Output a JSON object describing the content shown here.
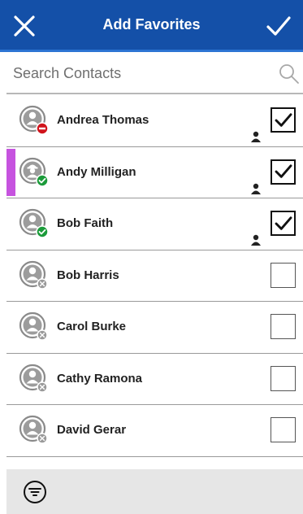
{
  "header": {
    "title": "Add Favorites",
    "close_icon": "close-icon",
    "confirm_icon": "check-icon",
    "bg_color": "#1450a8"
  },
  "search": {
    "placeholder": "Search Contacts",
    "value": "",
    "icon": "search-icon"
  },
  "contacts": [
    {
      "name": "Andrea Thomas",
      "status": "busy",
      "checked": true,
      "highlight": false,
      "avatar_icon": "person-icon"
    },
    {
      "name": "Andy Milligan",
      "status": "available",
      "checked": true,
      "highlight": true,
      "avatar_icon": "hard-hat-person-icon"
    },
    {
      "name": "Bob Faith",
      "status": "available",
      "checked": true,
      "highlight": false,
      "avatar_icon": "person-icon"
    },
    {
      "name": "Bob Harris",
      "status": "offline",
      "checked": false,
      "highlight": false,
      "avatar_icon": "person-icon"
    },
    {
      "name": "Carol Burke",
      "status": "offline",
      "checked": false,
      "highlight": false,
      "avatar_icon": "person-icon"
    },
    {
      "name": "Cathy Ramona",
      "status": "offline",
      "checked": false,
      "highlight": false,
      "avatar_icon": "person-icon"
    },
    {
      "name": "David Gerar",
      "status": "offline",
      "checked": false,
      "highlight": false,
      "avatar_icon": "person-icon"
    }
  ],
  "status_colors": {
    "busy": "#d0141c",
    "available": "#1b9b3a",
    "offline": "#9a9a9a"
  },
  "accent_color": "#c653df",
  "footer": {
    "filter_icon": "filter-icon"
  }
}
